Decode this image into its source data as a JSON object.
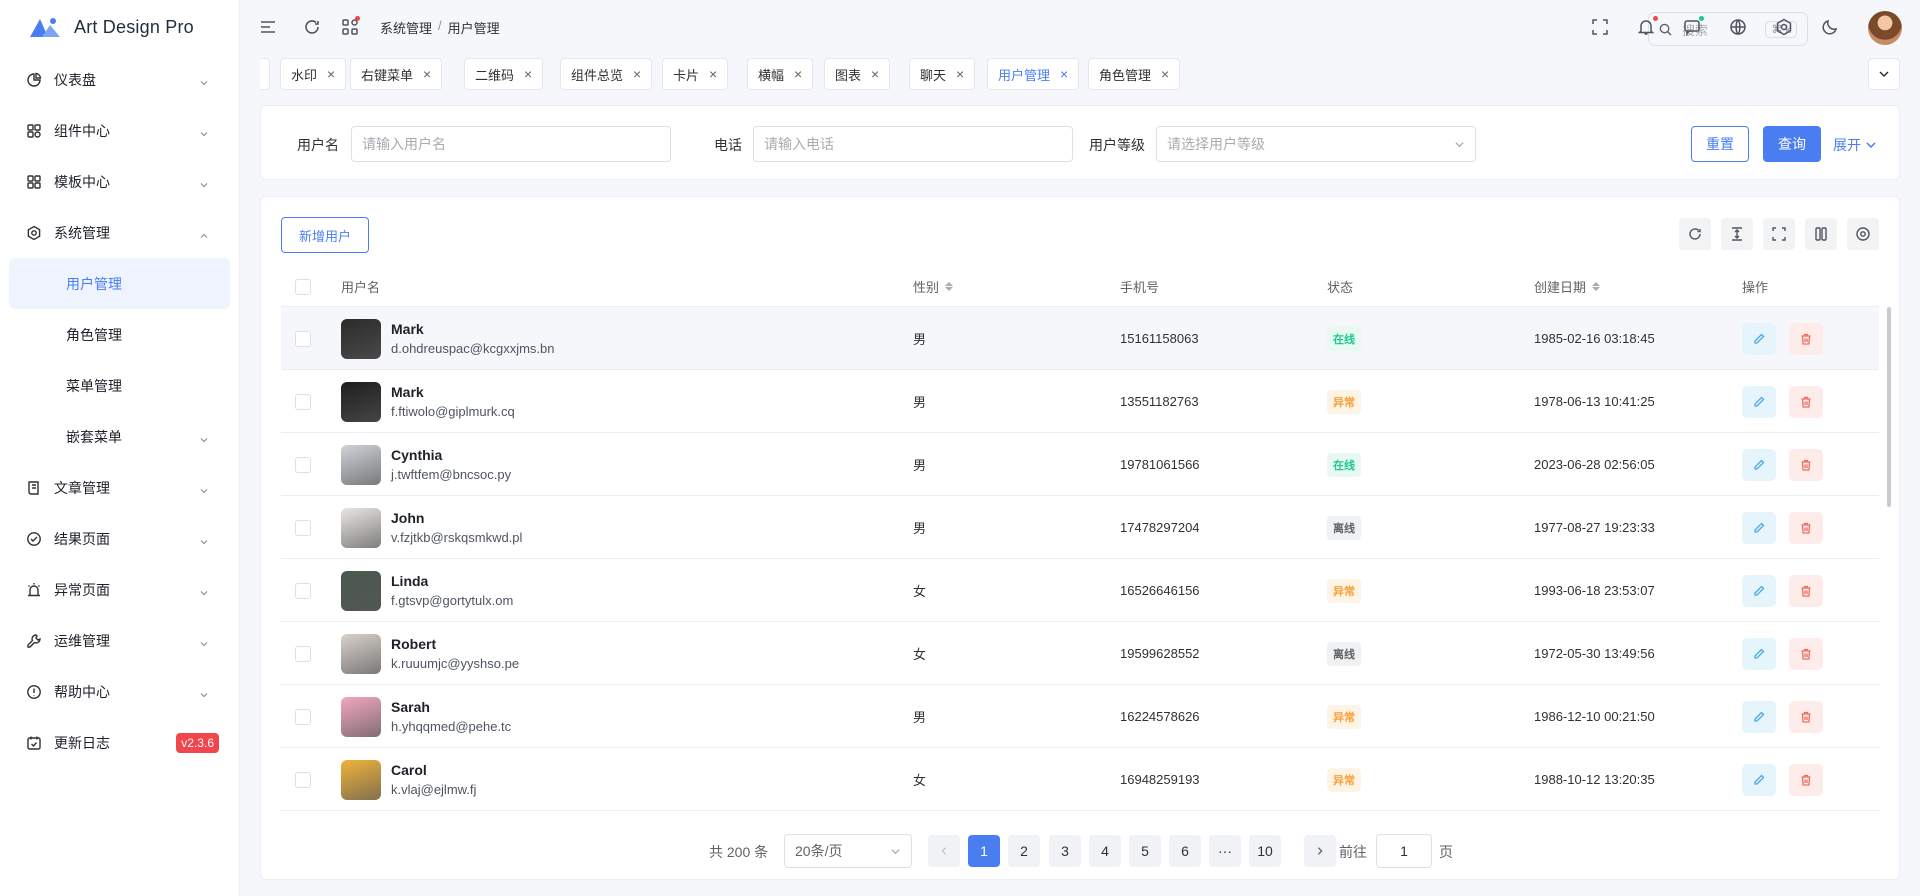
{
  "app": {
    "title": "Art Design Pro",
    "accent": "#4a7ef0"
  },
  "sidebar": {
    "items": [
      {
        "label": "仪表盘",
        "icon": "pie-chart-icon",
        "chevron": "down"
      },
      {
        "label": "组件中心",
        "icon": "apps-icon",
        "chevron": "down"
      },
      {
        "label": "模板中心",
        "icon": "grid-icon",
        "chevron": "down"
      },
      {
        "label": "系统管理",
        "icon": "gear-icon",
        "chevron": "up"
      },
      {
        "label": "用户管理",
        "sub": true,
        "active": true
      },
      {
        "label": "角色管理",
        "sub": true
      },
      {
        "label": "菜单管理",
        "sub": true
      },
      {
        "label": "嵌套菜单",
        "sub": true,
        "chevron": "down"
      },
      {
        "label": "文章管理",
        "icon": "article-icon",
        "chevron": "down"
      },
      {
        "label": "结果页面",
        "icon": "check-circle-icon",
        "chevron": "down"
      },
      {
        "label": "异常页面",
        "icon": "alarm-icon",
        "chevron": "down"
      },
      {
        "label": "运维管理",
        "icon": "wrench-icon",
        "chevron": "down"
      },
      {
        "label": "帮助中心",
        "icon": "info-icon",
        "chevron": "down"
      },
      {
        "label": "更新日志",
        "icon": "calendar-check-icon",
        "badge": "v2.3.6"
      }
    ]
  },
  "header": {
    "breadcrumb": [
      "系统管理",
      "用户管理"
    ],
    "search_placeholder": "搜索",
    "search_shortcut": "⌘ k"
  },
  "tabs": [
    {
      "label": "水印"
    },
    {
      "label": "右键菜单"
    },
    {
      "label": "二维码"
    },
    {
      "label": "组件总览"
    },
    {
      "label": "卡片"
    },
    {
      "label": "横幅"
    },
    {
      "label": "图表"
    },
    {
      "label": "聊天"
    },
    {
      "label": "用户管理",
      "active": true
    },
    {
      "label": "角色管理"
    }
  ],
  "filter": {
    "username_label": "用户名",
    "username_placeholder": "请输入用户名",
    "phone_label": "电话",
    "phone_placeholder": "请输入电话",
    "level_label": "用户等级",
    "level_placeholder": "请选择用户等级",
    "reset": "重置",
    "query": "查询",
    "expand": "展开"
  },
  "table": {
    "add_button": "新增用户",
    "columns": {
      "username": "用户名",
      "gender": "性别",
      "phone": "手机号",
      "status": "状态",
      "created": "创建日期",
      "actions": "操作"
    },
    "status_colors": {
      "在线": {
        "fg": "#1fc88f",
        "bg": "#e8f9f1"
      },
      "异常": {
        "fg": "#f5a23b",
        "bg": "#fef4e6"
      },
      "离线": {
        "fg": "#606266",
        "bg": "#f0f1f3"
      }
    },
    "rows": [
      {
        "name": "Mark",
        "email": "d.ohdreuspac@kcgxxjms.bn",
        "gender": "男",
        "phone": "15161158063",
        "status": "在线",
        "created": "1985-02-16 03:18:45",
        "avatar": "#2b2b2b"
      },
      {
        "name": "Mark",
        "email": "f.ftiwolo@giplmurk.cq",
        "gender": "男",
        "phone": "13551182763",
        "status": "异常",
        "created": "1978-06-13 10:41:25",
        "avatar": "#1e1e1e"
      },
      {
        "name": "Cynthia",
        "email": "j.twftfem@bncsoc.py",
        "gender": "男",
        "phone": "19781061566",
        "status": "在线",
        "created": "2023-06-28 02:56:05",
        "avatar": "#cfd3d8"
      },
      {
        "name": "John",
        "email": "v.fzjtkb@rskqsmkwd.pl",
        "gender": "男",
        "phone": "17478297204",
        "status": "离线",
        "created": "1977-08-27 19:23:33",
        "avatar": "#e9e6e2"
      },
      {
        "name": "Linda",
        "email": "f.gtsvp@gortytulx.om",
        "gender": "女",
        "phone": "16526646156",
        "status": "异常",
        "created": "1993-06-18 23:53:07",
        "avatar": "#4a5a4e"
      },
      {
        "name": "Robert",
        "email": "k.ruuumjc@yyshso.pe",
        "gender": "女",
        "phone": "19599628552",
        "status": "离线",
        "created": "1972-05-30 13:49:56",
        "avatar": "#d8d2cc"
      },
      {
        "name": "Sarah",
        "email": "h.yhqqmed@pehe.tc",
        "gender": "男",
        "phone": "16224578626",
        "status": "异常",
        "created": "1986-12-10 00:21:50",
        "avatar": "#f2a7c0"
      },
      {
        "name": "Carol",
        "email": "k.vlaj@ejlmw.fj",
        "gender": "女",
        "phone": "16948259193",
        "status": "异常",
        "created": "1988-10-12 13:20:35",
        "avatar": "#f0b33a"
      }
    ]
  },
  "pagination": {
    "total_text": "共 200 条",
    "page_size": "20条/页",
    "pages": [
      "1",
      "2",
      "3",
      "4",
      "5",
      "6",
      "···",
      "10"
    ],
    "current": "1",
    "goto_label": "前往",
    "goto_value": "1",
    "page_unit": "页"
  }
}
